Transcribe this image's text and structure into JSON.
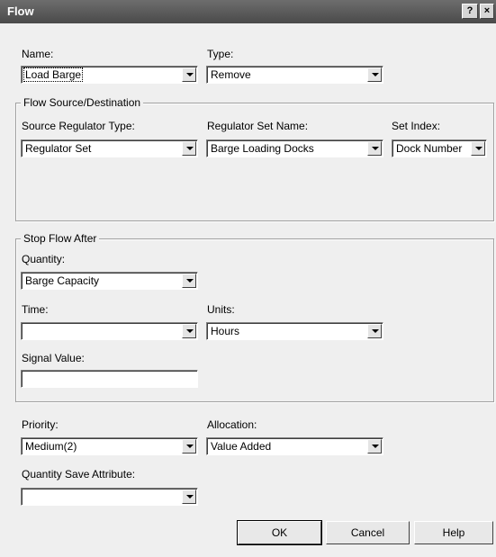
{
  "window": {
    "title": "Flow",
    "help_btn": "?",
    "close_btn": "×"
  },
  "name": {
    "label": "Name:",
    "value": "Load Barge"
  },
  "type": {
    "label": "Type:",
    "value": "Remove"
  },
  "flow_source": {
    "group_title": "Flow Source/Destination",
    "regulator_type": {
      "label": "Source Regulator Type:",
      "value": "Regulator Set"
    },
    "regulator_set_name": {
      "label": "Regulator Set Name:",
      "value": "Barge Loading Docks"
    },
    "set_index": {
      "label": "Set Index:",
      "value": "Dock Number"
    }
  },
  "stop_flow": {
    "group_title": "Stop Flow After",
    "quantity": {
      "label": "Quantity:",
      "value": "Barge Capacity"
    },
    "time": {
      "label": "Time:",
      "value": ""
    },
    "units": {
      "label": "Units:",
      "value": "Hours"
    },
    "signal_value": {
      "label": "Signal Value:",
      "value": ""
    }
  },
  "priority": {
    "label": "Priority:",
    "value": "Medium(2)"
  },
  "allocation": {
    "label": "Allocation:",
    "value": "Value Added"
  },
  "quantity_save": {
    "label": "Quantity Save Attribute:",
    "value": ""
  },
  "buttons": {
    "ok": "OK",
    "cancel": "Cancel",
    "help": "Help"
  }
}
